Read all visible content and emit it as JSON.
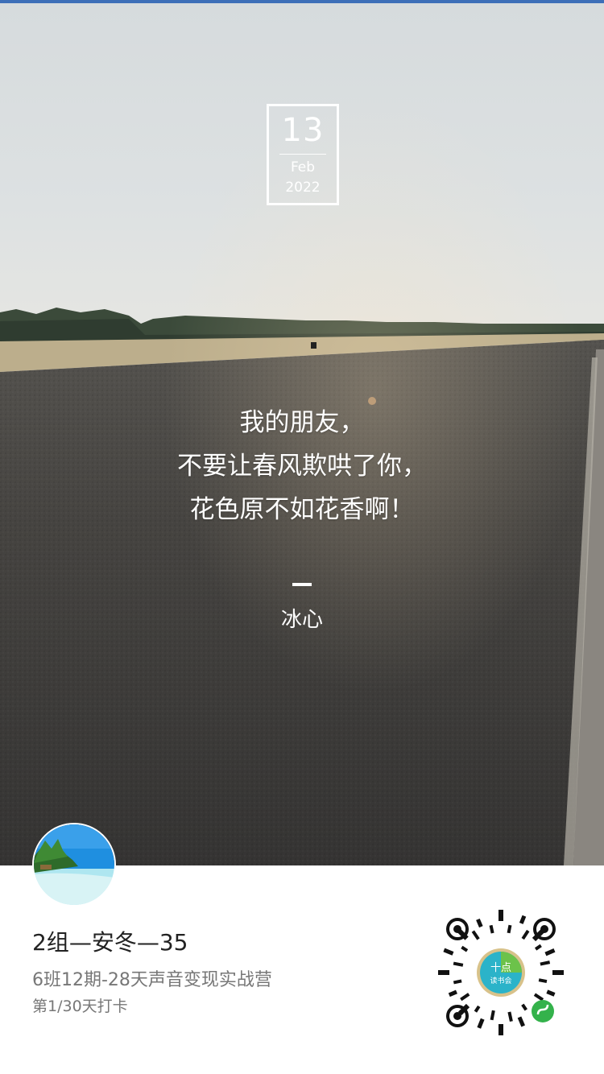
{
  "date": {
    "day": "13",
    "month": "Feb",
    "year": "2022"
  },
  "quote": {
    "lines": [
      "我的朋友，",
      "不要让春风欺哄了你，",
      "花色原不如花香啊！"
    ],
    "author": "冰心"
  },
  "user": {
    "name": "2组—安冬—35",
    "course": "6班12期-28天声音变现实战营",
    "progress": "第1/30天打卡"
  },
  "qr": {
    "logo_text_line1": "十点",
    "logo_text_line2": "读书会"
  },
  "colors": {
    "accent_topline": "#3d6fb8",
    "sky": "#d9dee0",
    "road": "#3f3e3c"
  }
}
